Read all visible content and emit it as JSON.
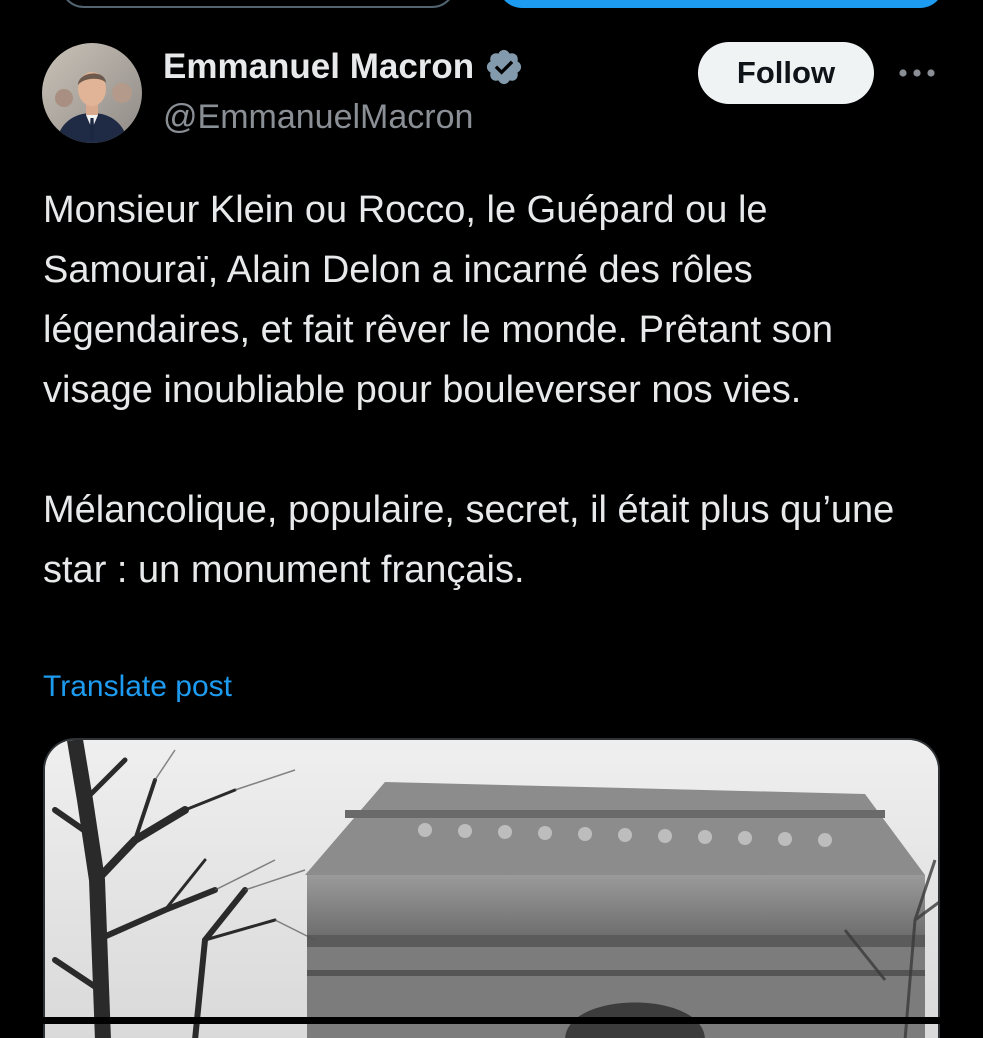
{
  "author": {
    "name": "Emmanuel Macron",
    "handle": "@EmmanuelMacron",
    "verified": true,
    "avatar_icon": "profile-photo"
  },
  "actions": {
    "follow_label": "Follow",
    "more_icon": "more-horizontal-icon"
  },
  "tweet": {
    "paragraphs": [
      "Monsieur Klein ou Rocco, le Guépard ou le Samouraï, Alain Delon a incarné des rôles légendaires, et fait rêver le monde. Prêtant son visage inoubliable pour bouleverser nos vies.",
      "Mélancolique, populaire, secret, il était plus qu’une star : un monument français."
    ],
    "translate_label": "Translate post"
  },
  "colors": {
    "background": "#000000",
    "text": "#e7e9ea",
    "secondary_text": "#8a8f95",
    "link": "#1d9bf0",
    "verified_badge": "#829aab",
    "follow_button_bg": "#eff3f4"
  }
}
